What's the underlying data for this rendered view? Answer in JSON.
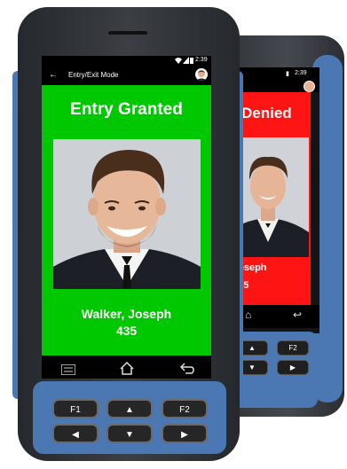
{
  "front": {
    "status_bar": {
      "time": "2:39"
    },
    "app_bar": {
      "title": "Entry/Exit Mode"
    },
    "result": {
      "title": "Entry Granted",
      "name": "Walker, Joseph",
      "id": "435"
    },
    "keypad": {
      "f1": "F1",
      "f2": "F2"
    },
    "colors": {
      "granted": "#00c800"
    }
  },
  "back": {
    "status_bar": {
      "time": "2:39"
    },
    "result": {
      "title": "Denied",
      "name": "Joseph",
      "id": "435"
    },
    "keypad": {
      "f2": "F2"
    },
    "colors": {
      "denied": "#ff1414"
    }
  },
  "icons": [
    "back-arrow-icon",
    "wifi-icon",
    "signal-icon",
    "battery-icon",
    "avatar",
    "menu-icon",
    "home-icon",
    "return-icon",
    "up-arrow-icon",
    "down-arrow-icon",
    "left-arrow-icon",
    "right-arrow-icon"
  ]
}
